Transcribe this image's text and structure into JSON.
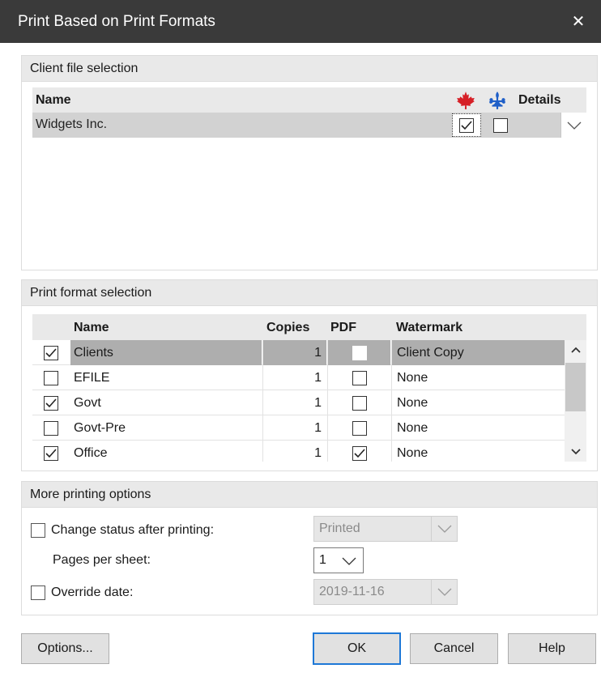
{
  "window": {
    "title": "Print Based on Print Formats",
    "close_glyph": "✕"
  },
  "client_section": {
    "title": "Client file selection",
    "headers": {
      "name": "Name",
      "details": "Details"
    },
    "icons": {
      "federal": "maple-leaf-icon",
      "quebec": "fleur-de-lis-icon"
    },
    "colors": {
      "federal": "#d61f26",
      "quebec": "#1f5fc8"
    },
    "rows": [
      {
        "name": "Widgets Inc.",
        "federal_checked": true,
        "quebec_checked": false
      }
    ]
  },
  "format_section": {
    "title": "Print format selection",
    "headers": {
      "name": "Name",
      "copies": "Copies",
      "pdf": "PDF",
      "watermark": "Watermark"
    },
    "rows": [
      {
        "checked": true,
        "name": "Clients",
        "copies": "1",
        "pdf": false,
        "watermark": "Client Copy",
        "selected": true
      },
      {
        "checked": false,
        "name": "EFILE",
        "copies": "1",
        "pdf": false,
        "watermark": "None",
        "selected": false
      },
      {
        "checked": true,
        "name": "Govt",
        "copies": "1",
        "pdf": false,
        "watermark": "None",
        "selected": false
      },
      {
        "checked": false,
        "name": "Govt-Pre",
        "copies": "1",
        "pdf": false,
        "watermark": "None",
        "selected": false
      },
      {
        "checked": true,
        "name": "Office",
        "copies": "1",
        "pdf": true,
        "watermark": "None",
        "selected": false
      }
    ]
  },
  "options_section": {
    "title": "More printing options",
    "change_status": {
      "label": "Change status after printing:",
      "checked": false,
      "value": "Printed"
    },
    "pages_per_sheet": {
      "label": "Pages per sheet:",
      "value": "1"
    },
    "override_date": {
      "label": "Override date:",
      "checked": false,
      "value": "2019-11-16"
    }
  },
  "buttons": {
    "options": "Options...",
    "ok": "OK",
    "cancel": "Cancel",
    "help": "Help"
  }
}
